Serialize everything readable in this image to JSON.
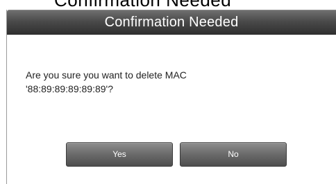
{
  "page": {
    "background_title_fragment": "Confirmation Needed"
  },
  "dialog": {
    "title": "Confirmation Needed",
    "message_line1": "Are you sure you want to delete MAC",
    "message_line2": "'88:89:89:89:89:89'?",
    "buttons": {
      "yes_label": "Yes",
      "no_label": "No"
    }
  },
  "colors": {
    "header_gradient_top": "#6f6f6f",
    "header_gradient_bottom": "#2f2f2f",
    "button_gradient_top": "#8d8d8d",
    "button_gradient_bottom": "#4e4e4e",
    "title_text": "#ffffff",
    "message_text": "#222222"
  }
}
